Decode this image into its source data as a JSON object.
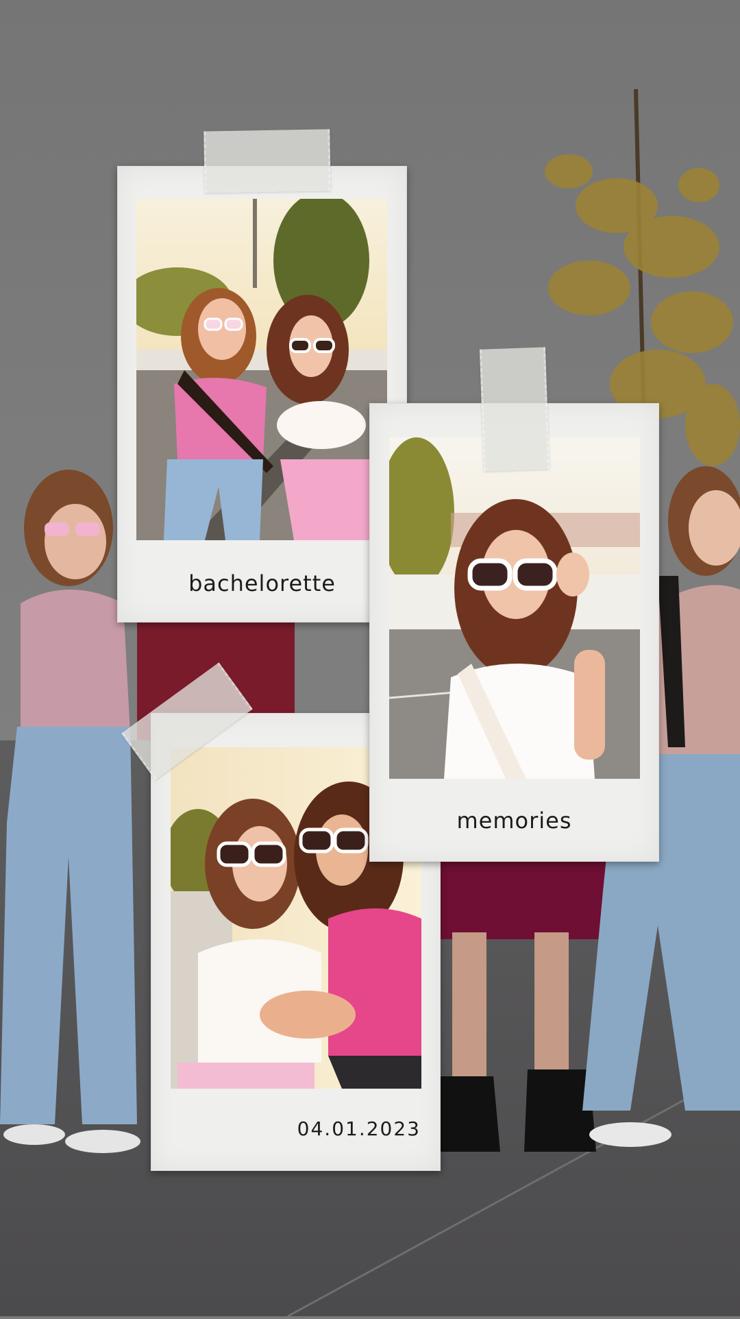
{
  "polaroids": [
    {
      "caption": "bachelorette"
    },
    {
      "caption": "memories"
    },
    {
      "caption": "04.01.2023"
    }
  ],
  "colors": {
    "background": "#7a7a7a",
    "frame": "#efefed",
    "sky": "#f3e6c4",
    "pink": "#e77fb3",
    "denim": "#8fb0d0",
    "sash_black": "#2a1c14",
    "tree": "#b89a43"
  }
}
